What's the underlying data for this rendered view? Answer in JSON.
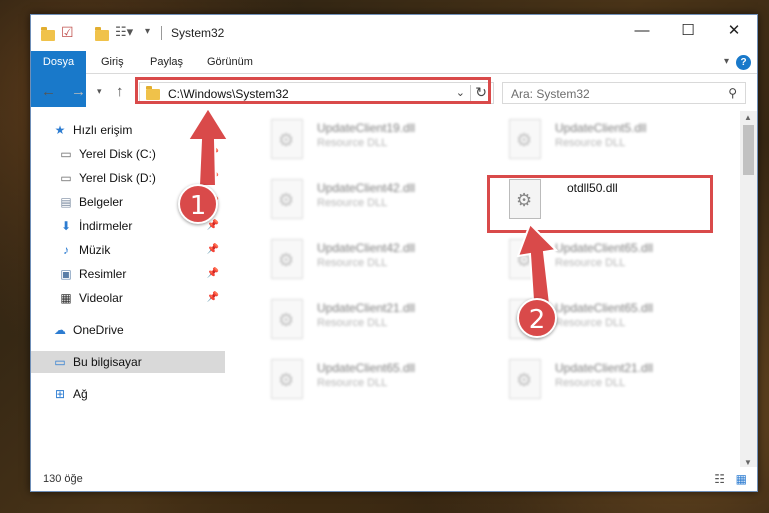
{
  "window": {
    "title": "System32",
    "controls": {
      "minimize": "—",
      "maximize": "☐",
      "close": "✕"
    }
  },
  "ribbon": {
    "tabs": [
      "Dosya",
      "Giriş",
      "Paylaş",
      "Görünüm"
    ],
    "help": "?"
  },
  "nav": {
    "address": "C:\\Windows\\System32",
    "search_placeholder": "Ara: System32"
  },
  "sidebar": {
    "quick_access": "Hızlı erişim",
    "items": [
      {
        "label": "Yerel Disk (C:)",
        "icon": "drive-icon",
        "pinned": true
      },
      {
        "label": "Yerel Disk (D:)",
        "icon": "drive-icon",
        "pinned": true
      },
      {
        "label": "Belgeler",
        "icon": "documents-icon",
        "pinned": true
      },
      {
        "label": "İndirmeler",
        "icon": "downloads-icon",
        "pinned": true
      },
      {
        "label": "Müzik",
        "icon": "music-icon",
        "pinned": true
      },
      {
        "label": "Resimler",
        "icon": "pictures-icon",
        "pinned": true
      },
      {
        "label": "Videolar",
        "icon": "videos-icon",
        "pinned": true
      }
    ],
    "onedrive": "OneDrive",
    "this_pc": "Bu bilgisayar",
    "network": "Ağ"
  },
  "files": {
    "left": [
      {
        "name": "UpdateClient19.dll",
        "desc": "Resource DLL"
      },
      {
        "name": "UpdateClient42.dll",
        "desc": "Resource DLL"
      },
      {
        "name": "UpdateClient42.dll",
        "desc": "Resource DLL"
      },
      {
        "name": "UpdateClient21.dll",
        "desc": "Resource DLL"
      },
      {
        "name": "UpdateClient65.dll",
        "desc": "Resource DLL"
      }
    ],
    "right": [
      {
        "name": "UpdateClient5.dll",
        "desc": "Resource DLL"
      },
      {
        "name": "otdll50.dll",
        "desc": ""
      },
      {
        "name": "UpdateClient65.dll",
        "desc": "Resource DLL"
      },
      {
        "name": "UpdateClient65.dll",
        "desc": "Resource DLL"
      },
      {
        "name": "UpdateClient21.dll",
        "desc": "Resource DLL"
      }
    ]
  },
  "status": {
    "count": "130 öğe"
  },
  "callouts": [
    "1",
    "2"
  ],
  "colors": {
    "accent": "#1979ca",
    "highlight": "#d94a4a",
    "folder": "#f0c24a"
  }
}
